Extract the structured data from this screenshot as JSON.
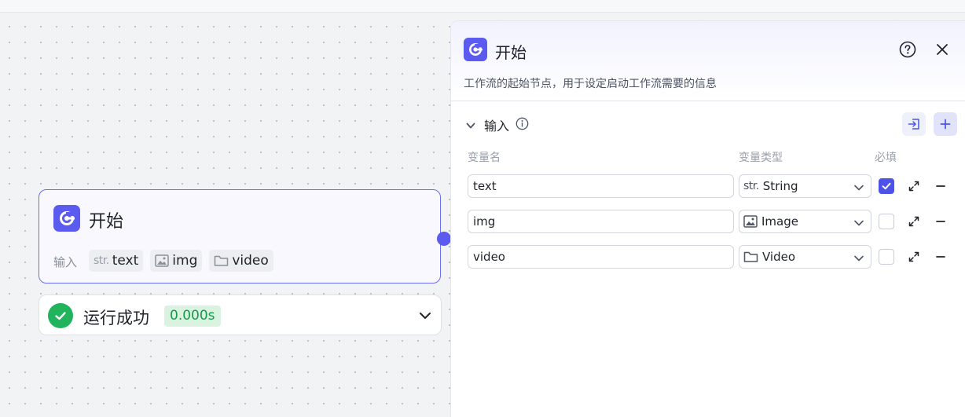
{
  "node": {
    "title": "开始",
    "input_label": "输入",
    "inputs": [
      {
        "type_icon": "str.",
        "name": "text"
      },
      {
        "type_icon": "image-icon",
        "name": "img"
      },
      {
        "type_icon": "folder-icon",
        "name": "video"
      }
    ]
  },
  "run": {
    "status": "运行成功",
    "duration": "0.000s"
  },
  "panel": {
    "title": "开始",
    "description": "工作流的起始节点，用于设定启动工作流需要的信息",
    "section_title": "输入",
    "columns": {
      "name": "变量名",
      "type": "变量类型",
      "required": "必填"
    },
    "variables": [
      {
        "name": "text",
        "type_prefix": "str.",
        "type": "String",
        "type_icon": "str-icon",
        "required": true
      },
      {
        "name": "img",
        "type_prefix": "",
        "type": "Image",
        "type_icon": "image-icon",
        "required": false
      },
      {
        "name": "video",
        "type_prefix": "",
        "type": "Video",
        "type_icon": "folder-icon",
        "required": false
      }
    ]
  },
  "colors": {
    "accent": "#5b5bf0",
    "success": "#22b45c",
    "success_bg": "#daf3e1"
  }
}
